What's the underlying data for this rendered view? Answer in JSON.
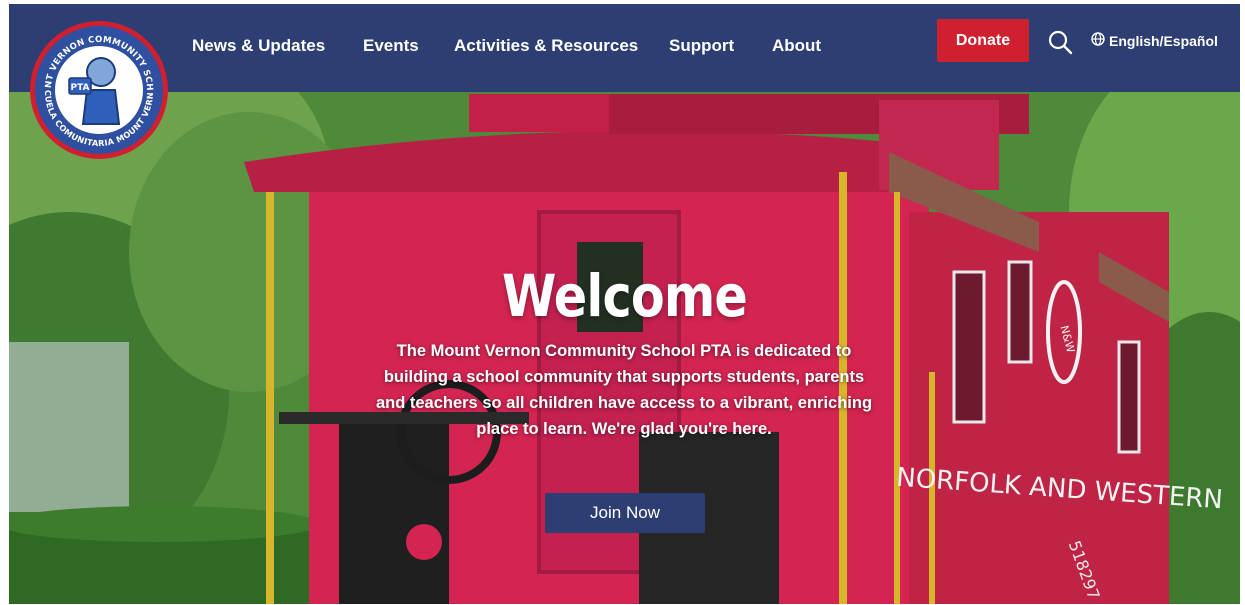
{
  "logo": {
    "top_text": "MOUNT VERNON COMMUNITY SCHOOL",
    "bottom_text": "ESCUELA COMUNITARIA MOUNT VERNON",
    "center_text": "PTA"
  },
  "nav": {
    "items": [
      {
        "label": "News & Updates"
      },
      {
        "label": "Events"
      },
      {
        "label": "Activities & Resources"
      },
      {
        "label": "Support"
      },
      {
        "label": "About"
      }
    ],
    "donate_label": "Donate",
    "search_icon": "search-icon",
    "language_icon": "globe-icon",
    "language_label": "English/Español"
  },
  "hero": {
    "title": "Welcome",
    "body": "The Mount Vernon Community School PTA is dedicated to building a school community that supports students, parents and teachers so all children have access to a vibrant, enriching place to learn. We're glad you're here.",
    "cta_label": "Join Now",
    "caboose_text": "NORFOLK AND WESTERN",
    "caboose_number": "518297",
    "emblem_text": "N&W"
  },
  "colors": {
    "header_bg": "#2c3e72",
    "donate_bg": "#d0202f",
    "cta_bg": "#2c3e72",
    "caboose_red": "#d42552"
  }
}
